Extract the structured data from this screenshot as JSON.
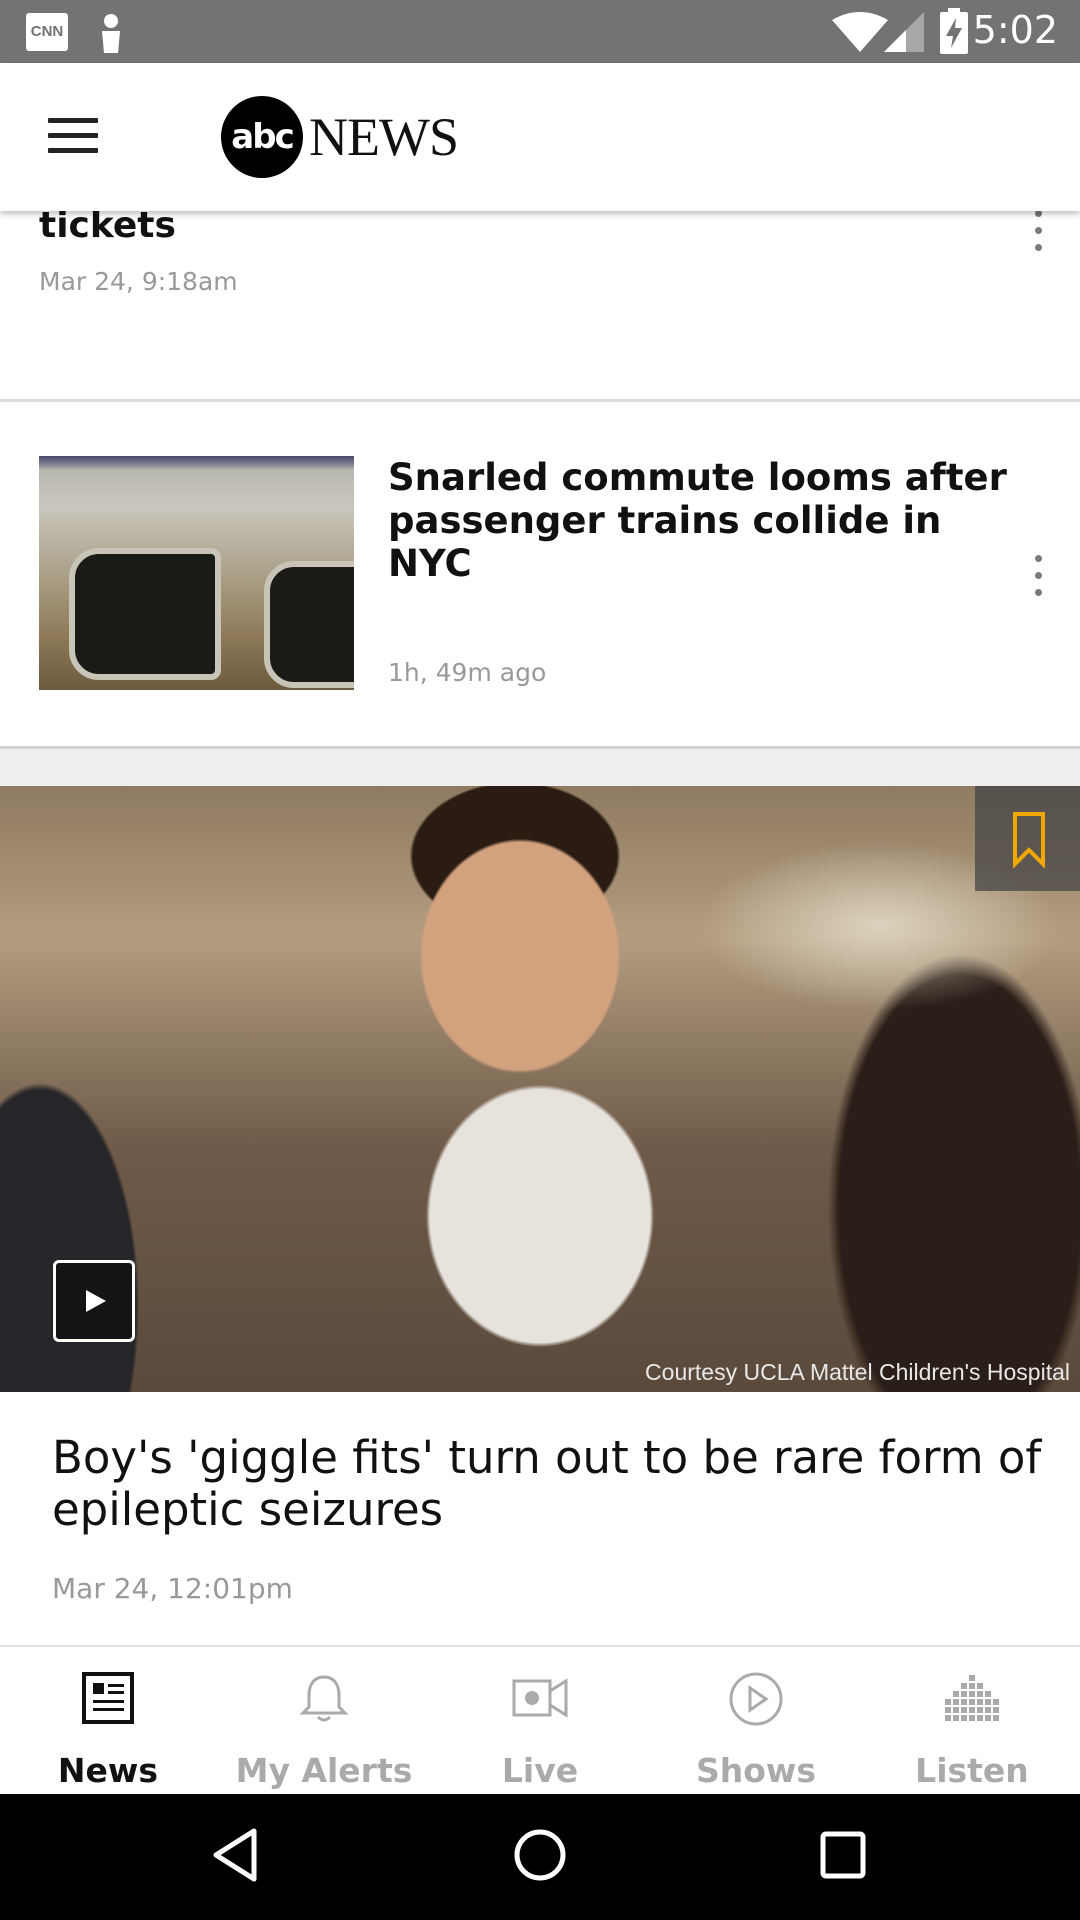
{
  "status_bar": {
    "time": "5:02",
    "icons": [
      "cnn-notification-icon",
      "person-notification-icon",
      "wifi-icon",
      "signal-icon",
      "battery-charging-icon"
    ],
    "cnn_label": "CNN"
  },
  "header": {
    "logo_abc": "abc",
    "logo_news": "NEWS"
  },
  "feed": {
    "story1": {
      "title": "tickets",
      "date": "Mar 24, 9:18am"
    },
    "story2": {
      "title": "Snarled commute looms after passenger trains collide in NYC",
      "time": "1h, 49m ago"
    },
    "story3": {
      "title": "Boy's 'giggle fits' turn out to be rare form of epileptic seizures",
      "date": "Mar 24, 12:01pm",
      "credit": "Courtesy UCLA Mattel Children's Hospital"
    }
  },
  "tabs": [
    {
      "label": "News",
      "icon": "news-icon",
      "active": true
    },
    {
      "label": "My Alerts",
      "icon": "bell-icon",
      "active": false
    },
    {
      "label": "Live",
      "icon": "video-camera-icon",
      "active": false
    },
    {
      "label": "Shows",
      "icon": "play-circle-icon",
      "active": false
    },
    {
      "label": "Listen",
      "icon": "equalizer-icon",
      "active": false
    }
  ],
  "colors": {
    "bookmark": "#f0a800",
    "active_tab": "#111111",
    "inactive_tab": "#aaaaaa"
  }
}
